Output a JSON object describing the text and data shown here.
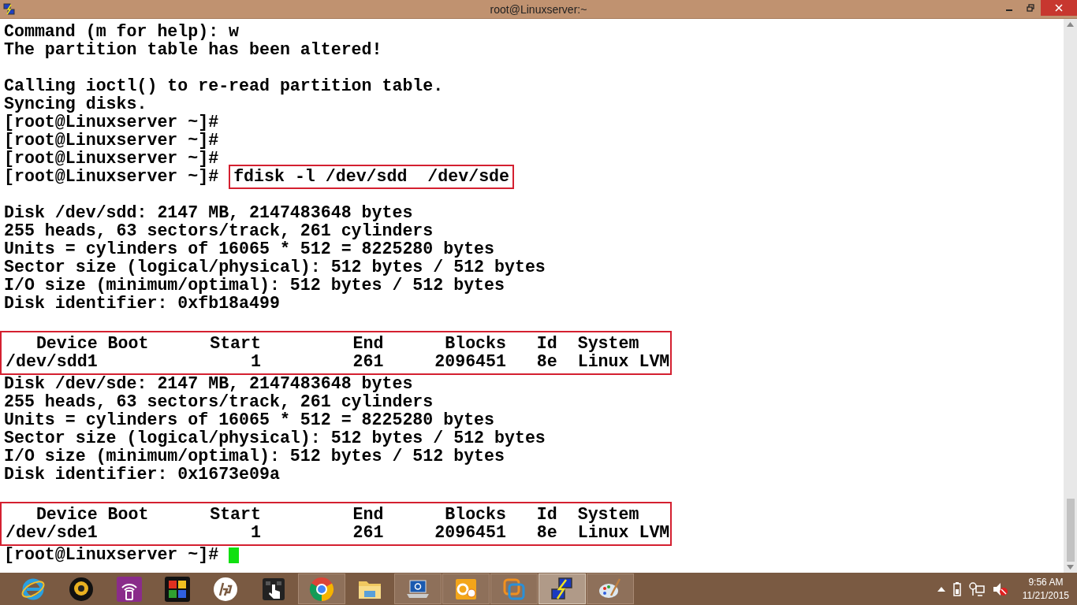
{
  "window": {
    "title": "root@Linuxserver:~"
  },
  "terminal": {
    "lines": [
      {
        "kind": "text",
        "text": "Command (m for help): w"
      },
      {
        "kind": "text",
        "text": "The partition table has been altered!"
      },
      {
        "kind": "blank"
      },
      {
        "kind": "text",
        "text": "Calling ioctl() to re-read partition table."
      },
      {
        "kind": "text",
        "text": "Syncing disks."
      },
      {
        "kind": "text",
        "text": "[root@Linuxserver ~]#"
      },
      {
        "kind": "text",
        "text": "[root@Linuxserver ~]#"
      },
      {
        "kind": "text",
        "text": "[root@Linuxserver ~]#"
      },
      {
        "kind": "command",
        "prompt": "[root@Linuxserver ~]#",
        "command": "fdisk -l /dev/sdd  /dev/sde"
      },
      {
        "kind": "blank"
      },
      {
        "kind": "text",
        "text": "Disk /dev/sdd: 2147 MB, 2147483648 bytes"
      },
      {
        "kind": "text",
        "text": "255 heads, 63 sectors/track, 261 cylinders"
      },
      {
        "kind": "text",
        "text": "Units = cylinders of 16065 * 512 = 8225280 bytes"
      },
      {
        "kind": "text",
        "text": "Sector size (logical/physical): 512 bytes / 512 bytes"
      },
      {
        "kind": "text",
        "text": "I/O size (minimum/optimal): 512 bytes / 512 bytes"
      },
      {
        "kind": "text",
        "text": "Disk identifier: 0xfb18a499"
      },
      {
        "kind": "blank"
      },
      {
        "kind": "boxed",
        "rows": [
          "   Device Boot      Start         End      Blocks   Id  System",
          "/dev/sdd1               1         261     2096451   8e  Linux LVM"
        ]
      },
      {
        "kind": "text",
        "text": "Disk /dev/sde: 2147 MB, 2147483648 bytes"
      },
      {
        "kind": "text",
        "text": "255 heads, 63 sectors/track, 261 cylinders"
      },
      {
        "kind": "text",
        "text": "Units = cylinders of 16065 * 512 = 8225280 bytes"
      },
      {
        "kind": "text",
        "text": "Sector size (logical/physical): 512 bytes / 512 bytes"
      },
      {
        "kind": "text",
        "text": "I/O size (minimum/optimal): 512 bytes / 512 bytes"
      },
      {
        "kind": "text",
        "text": "Disk identifier: 0x1673e09a"
      },
      {
        "kind": "blank"
      },
      {
        "kind": "boxed",
        "rows": [
          "   Device Boot      Start         End      Blocks   Id  System",
          "/dev/sde1               1         261     2096451   8e  Linux LVM"
        ]
      },
      {
        "kind": "cursor",
        "prompt": "[root@Linuxserver ~]#"
      }
    ]
  },
  "taskbar": {
    "apps": [
      {
        "kind": "ie",
        "open": false,
        "selected": false
      },
      {
        "kind": "webcam",
        "open": false,
        "selected": false
      },
      {
        "kind": "wireless",
        "open": false,
        "selected": false
      },
      {
        "kind": "puzzle",
        "open": false,
        "selected": false
      },
      {
        "kind": "hp",
        "open": false,
        "selected": false
      },
      {
        "kind": "touch",
        "open": false,
        "selected": false
      },
      {
        "kind": "chrome",
        "open": true,
        "selected": false
      },
      {
        "kind": "folder",
        "open": false,
        "selected": false
      },
      {
        "kind": "laptop",
        "open": true,
        "selected": false
      },
      {
        "kind": "outlook",
        "open": true,
        "selected": false
      },
      {
        "kind": "vmware",
        "open": true,
        "selected": false
      },
      {
        "kind": "putty",
        "open": true,
        "selected": true
      },
      {
        "kind": "paint",
        "open": true,
        "selected": false
      }
    ],
    "clock": {
      "time": "9:56 AM",
      "date": "11/21/2015"
    }
  }
}
